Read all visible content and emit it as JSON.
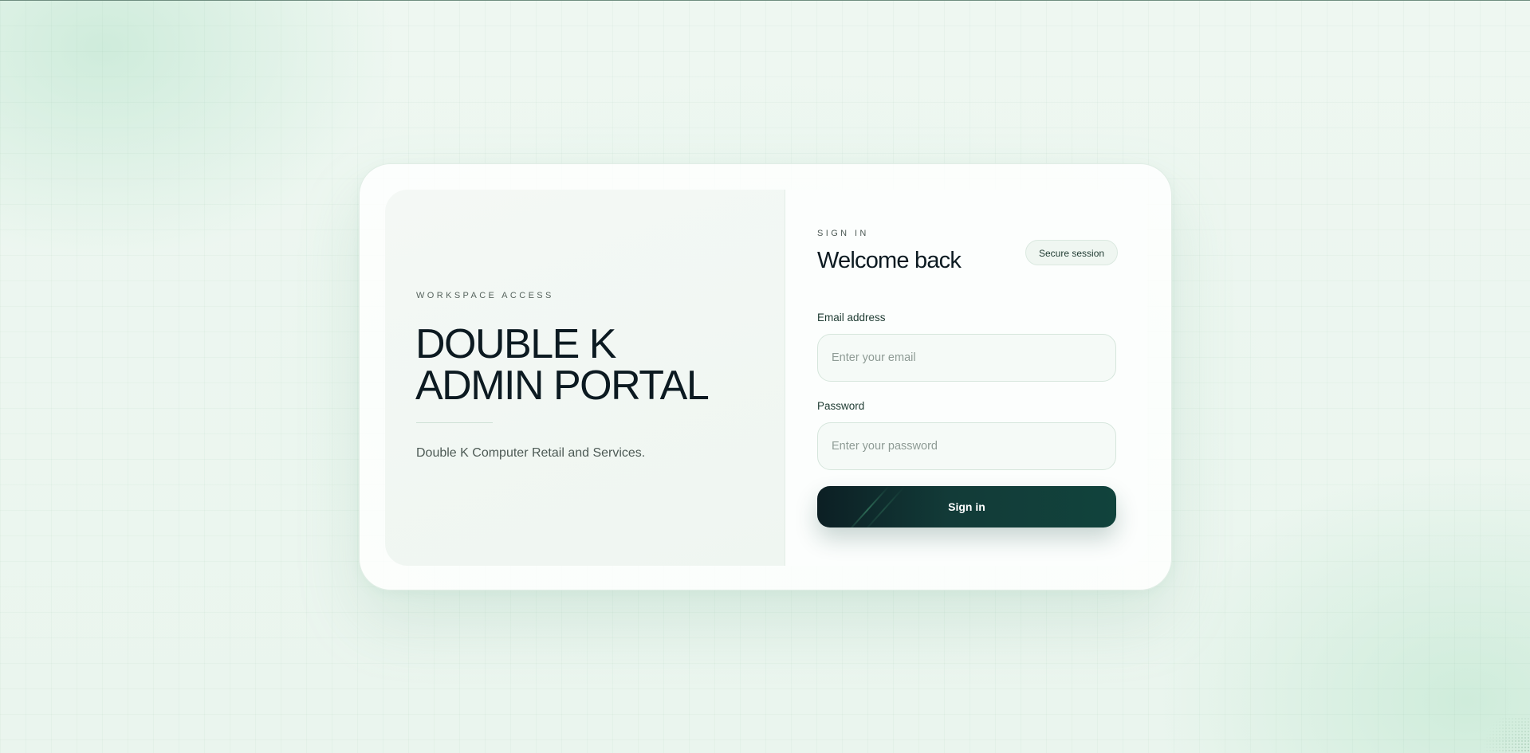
{
  "left_panel": {
    "eyebrow": "WORKSPACE ACCESS",
    "title_line1": "DOUBLE K",
    "title_line2": "ADMIN PORTAL",
    "tagline": "Double K Computer Retail and Services."
  },
  "signin": {
    "eyebrow": "SIGN IN",
    "heading": "Welcome back",
    "badge": "Secure session",
    "email_label": "Email address",
    "email_placeholder": "Enter your email",
    "email_value": "",
    "password_label": "Password",
    "password_placeholder": "Enter your password",
    "password_value": "",
    "submit_label": "Sign in"
  },
  "colors": {
    "accent_dark": "#0c1f24",
    "accent_green": "#11433c",
    "text_primary": "#0c1a21",
    "background_tint": "#eef7f1"
  }
}
